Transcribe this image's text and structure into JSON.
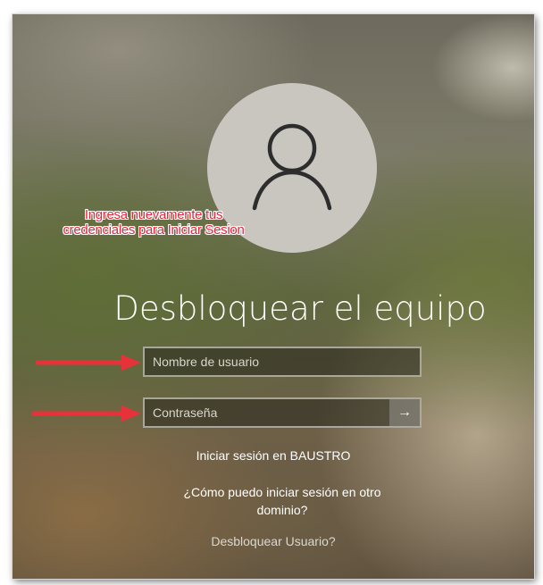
{
  "annotation": {
    "text": "Ingresa nuevamente tus credenciales para Iniciar Sesion",
    "color": "#e8233a"
  },
  "avatar": {
    "icon": "user-silhouette-icon"
  },
  "title": "Desbloquear el equipo",
  "username": {
    "placeholder": "Nombre de usuario"
  },
  "password": {
    "placeholder": "Contraseña",
    "submit_icon": "arrow-right-icon",
    "submit_glyph": "→"
  },
  "links": {
    "sign_in_domain": "Iniciar sesión en BAUSTRO",
    "other_domain": "¿Cómo puedo iniciar sesión en otro dominio?",
    "unlock_user": "Desbloquear Usuario?"
  },
  "arrows": {
    "color": "#e8323a"
  }
}
